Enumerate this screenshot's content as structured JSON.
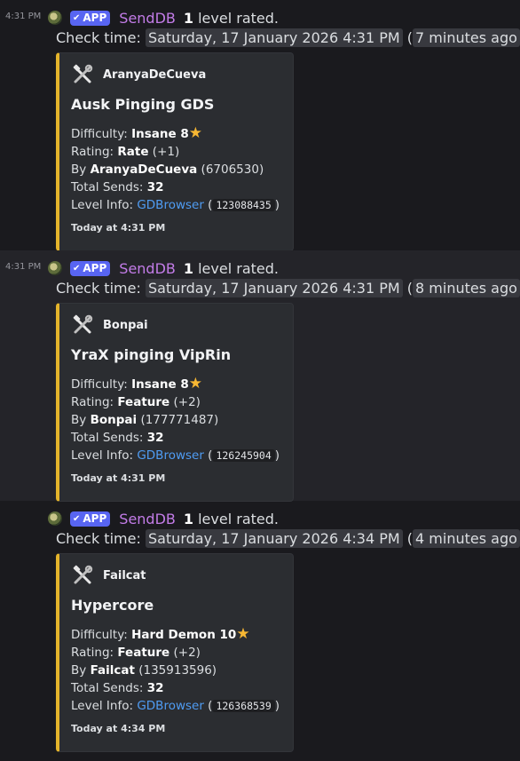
{
  "messages": [
    {
      "timestamp": "4:31 PM",
      "badge": "APP",
      "app_name": "SendDB",
      "count": "1",
      "rated_text": "level rated.",
      "check_label": "Check time:",
      "check_time": "Saturday, 17 January 2026 4:31 PM",
      "ago": "7 minutes ago",
      "embed": {
        "author": "AranyaDeCueva",
        "title": "Ausk Pinging GDS",
        "difficulty_label": "Difficulty:",
        "difficulty": "Insane 8",
        "rating_label": "Rating:",
        "rating": "Rate",
        "rating_bonus": "(+1)",
        "by_label": "By",
        "creator": "AranyaDeCueva",
        "creator_id": "(6706530)",
        "sends_label": "Total Sends:",
        "sends": "32",
        "info_label": "Level Info:",
        "link": "GDBrowser",
        "level_id": "123088435",
        "footer": "Today at 4:31 PM"
      }
    },
    {
      "timestamp": "4:31 PM",
      "badge": "APP",
      "app_name": "SendDB",
      "count": "1",
      "rated_text": "level rated.",
      "check_label": "Check time:",
      "check_time": "Saturday, 17 January 2026 4:31 PM",
      "ago": "8 minutes ago",
      "embed": {
        "author": "Bonpai",
        "title": "YraX pinging VipRin",
        "difficulty_label": "Difficulty:",
        "difficulty": "Insane 8",
        "rating_label": "Rating:",
        "rating": "Feature",
        "rating_bonus": "(+2)",
        "by_label": "By",
        "creator": "Bonpai",
        "creator_id": "(177771487)",
        "sends_label": "Total Sends:",
        "sends": "32",
        "info_label": "Level Info:",
        "link": "GDBrowser",
        "level_id": "126245904",
        "footer": "Today at 4:31 PM"
      }
    },
    {
      "timestamp": "",
      "badge": "APP",
      "app_name": "SendDB",
      "count": "1",
      "rated_text": "level rated.",
      "check_label": "Check time:",
      "check_time": "Saturday, 17 January 2026 4:34 PM",
      "ago": "4 minutes ago",
      "embed": {
        "author": "Failcat",
        "title": "Hypercore",
        "difficulty_label": "Difficulty:",
        "difficulty": "Hard Demon 10",
        "rating_label": "Rating:",
        "rating": "Feature",
        "rating_bonus": "(+2)",
        "by_label": "By",
        "creator": "Failcat",
        "creator_id": "(135913596)",
        "sends_label": "Total Sends:",
        "sends": "32",
        "info_label": "Level Info:",
        "link": "GDBrowser",
        "level_id": "126368539",
        "footer": "Today at 4:34 PM"
      }
    }
  ],
  "colors": {
    "accent": "#e4b42b",
    "app_name": "#c37ce8",
    "badge": "#5865f2",
    "link": "#4f9cf3",
    "star": "#f7b733"
  },
  "icons": {
    "author": "hammer-wrench-icon",
    "badge_check": "check-icon",
    "difficulty_star": "star-icon"
  }
}
